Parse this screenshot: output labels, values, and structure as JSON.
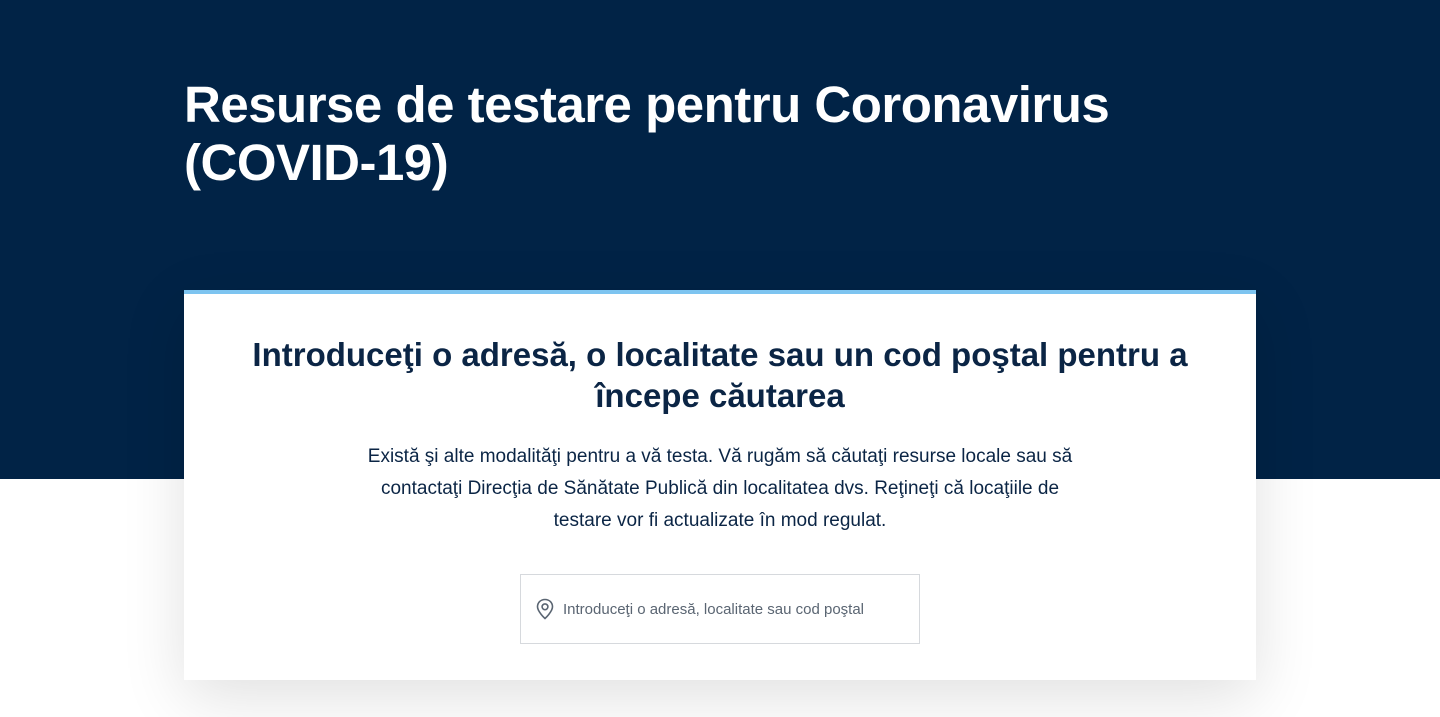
{
  "hero": {
    "title": "Resurse de testare pentru Coronavirus (COVID-19)"
  },
  "card": {
    "heading": "Introduceţi o adresă, o localitate sau un cod poştal pentru a începe căutarea",
    "description": "Există şi alte modalităţi pentru a vă testa. Vă rugăm să căutaţi resurse locale sau să contactaţi Direcţia de Sănătate Publică din localitatea dvs. Reţineţi că locaţiile de testare vor fi actualizate în mod regulat.",
    "search": {
      "placeholder": "Introduceţi o adresă, localitate sau cod poştal",
      "value": "",
      "icon": "location-pin-icon"
    }
  },
  "colors": {
    "hero_background": "#012346",
    "accent_border": "#7dc4f0",
    "heading_text": "#0b2545"
  }
}
